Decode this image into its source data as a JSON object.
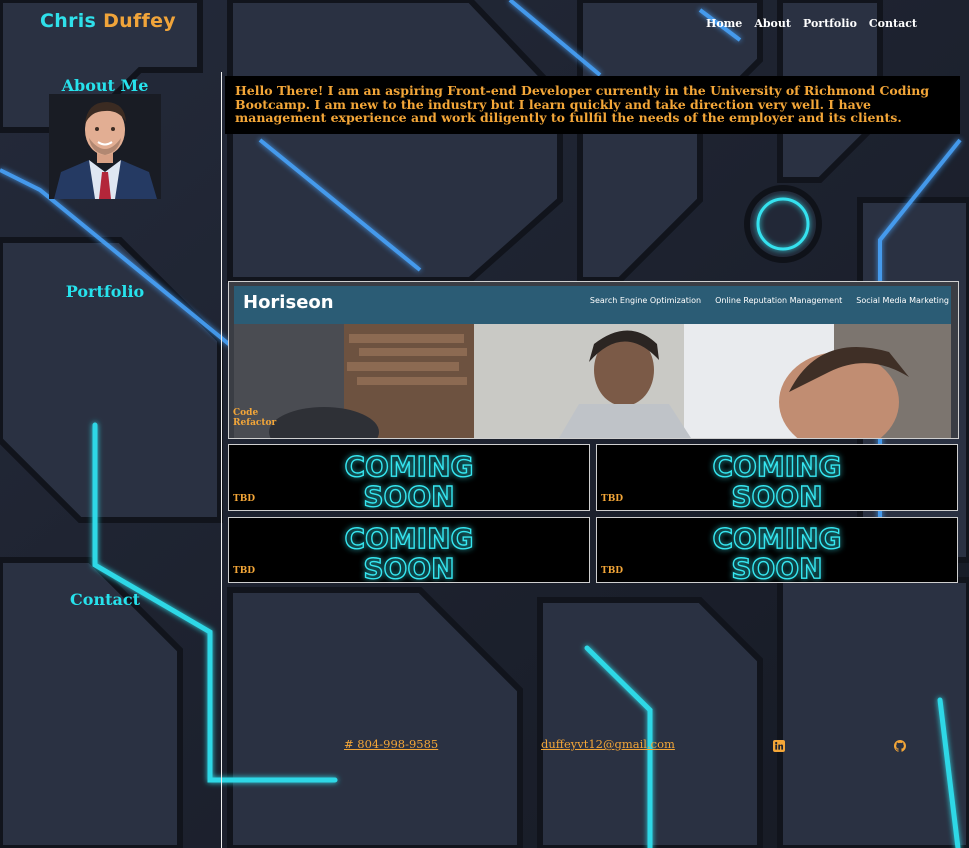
{
  "brand": {
    "first": "Chris",
    "last": "Duffey"
  },
  "nav": {
    "items": [
      "Home",
      "About",
      "Portfolio",
      "Contact"
    ]
  },
  "sidebar": {
    "about": "About Me",
    "portfolio": "Portfolio",
    "contact": "Contact"
  },
  "intro": {
    "text": "Hello There! I am an aspiring Front-end Developer currently in the University of Richmond Coding Bootcamp. I am new to the industry but I learn quickly and take direction very well. I have management experience and work diligently to fullfil the needs of the employer and its clients."
  },
  "featured": {
    "logo": "Horiseon",
    "menu": [
      "Search Engine Optimization",
      "Online Reputation Management",
      "Social Media Marketing"
    ],
    "label_line1": "Code",
    "label_line2": "Refactor"
  },
  "cards": [
    {
      "label": "TBD",
      "line1": "COMING",
      "line2": "SOON"
    },
    {
      "label": "TBD",
      "line1": "COMING",
      "line2": "SOON"
    },
    {
      "label": "TBD",
      "line1": "COMING",
      "line2": "SOON"
    },
    {
      "label": "TBD",
      "line1": "COMING",
      "line2": "SOON"
    }
  ],
  "footer": {
    "phone": "# 804-998-9585",
    "email": "duffeyvt12@gmail.com",
    "linkedin_icon": "linkedin-icon",
    "github_icon": "github-icon"
  },
  "colors": {
    "accent_cyan": "#2fe0ea",
    "accent_orange": "#f3a638",
    "neon": "#34e6f0"
  }
}
